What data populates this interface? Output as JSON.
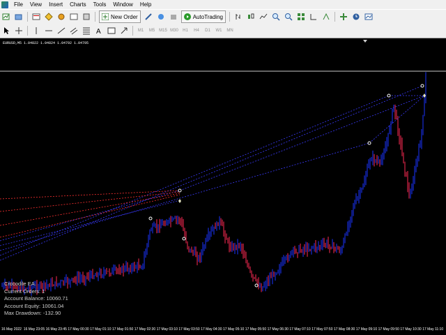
{
  "menu": [
    "File",
    "View",
    "Insert",
    "Charts",
    "Tools",
    "Window",
    "Help"
  ],
  "toolbar": {
    "new_order_label": "New Order",
    "autotrading_label": "AutoTrading",
    "timeframes": [
      "M1",
      "M5",
      "M15",
      "M30",
      "H1",
      "H4",
      "D1",
      "W1",
      "MN"
    ]
  },
  "chart": {
    "symbol_info": "EURUSD,M5  1.04822 1.04824 1.04792 1.04795",
    "time_labels": [
      "16 May 2022",
      "16 May 23:05",
      "16 May 23:45",
      "17 May 00:30",
      "17 May 01:10",
      "17 May 01:50",
      "17 May 02:30",
      "17 May 03:10",
      "17 May 03:50",
      "17 May 04:30",
      "17 May 05:10",
      "17 May 05:50",
      "17 May 06:30",
      "17 May 07:10",
      "17 May 07:50",
      "17 May 08:30",
      "17 May 09:10",
      "17 May 09:50",
      "17 May 10:30",
      "17 May 11:10"
    ]
  },
  "ea_panel": {
    "name": "Crocodile EA.",
    "current_orders": "Current Orders:  1",
    "balance": "Account Balance:  10060.71",
    "equity": "Account Equity:  10061.04",
    "drawdown": "Max Drawdown:  -132.90"
  },
  "colors": {
    "bull": "#1a33ff",
    "bear": "#ff2a55",
    "background": "#000000",
    "bid_line": "#c8c8c8"
  }
}
